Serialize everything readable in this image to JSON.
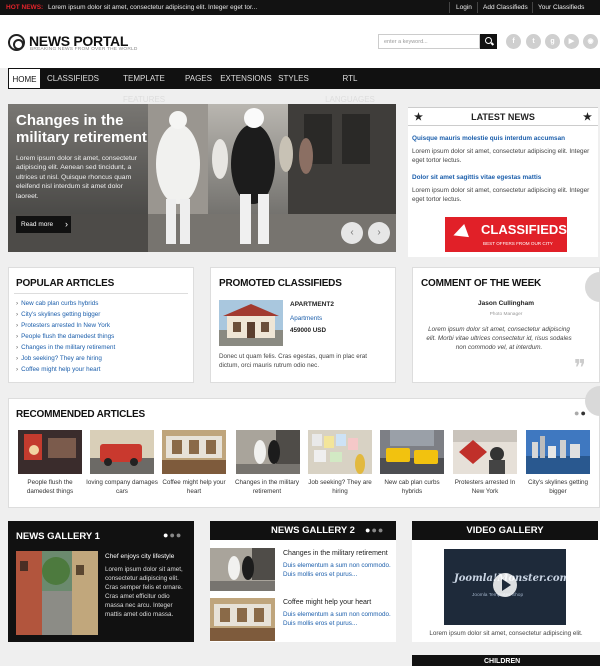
{
  "topbar": {
    "hot_label": "HOT NEWS:",
    "hot_text": "Lorem ipsum dolor sit amet, consectetur adipiscing elit. Integer eget tor...",
    "links": [
      "Login",
      "Add Classifieds",
      "Your Classifieds"
    ]
  },
  "header": {
    "logo_title": "NEWS PORTAL",
    "logo_tagline": "BREAKING NEWS FROM OVER THE WORLD",
    "search_placeholder": "enter a keyword...",
    "social_icons": [
      "facebook-icon",
      "twitter-icon",
      "googleplus-icon",
      "youtube-icon",
      "rss-icon"
    ]
  },
  "nav": {
    "items": [
      "HOME",
      "CLASSIFIEDS",
      "TEMPLATE FEATURES",
      "PAGES",
      "EXTENSIONS",
      "STYLES",
      "RTL LANGUAGES"
    ],
    "active": "HOME"
  },
  "slider": {
    "title_line1": "Changes in the",
    "title_line2": "military retirement",
    "text": "Lorem ipsum dolor sit amet, consectetur adipiscing elit. Aenean sed tincidunt, a ultrices ut nisl. Quisque rhoncus quam eleifend nisl interdum sit amet dolor laoreet.",
    "read_more": "Read more",
    "prev_arrow": "‹",
    "next_arrow": "›"
  },
  "latest_news": {
    "title": "LATEST NEWS",
    "items": [
      {
        "link": "Quisque mauris molestie quis interdum accumsan",
        "text": "Lorem ipsum dolor sit amet, consectetur adipiscing elit. Integer eget tortor lectus."
      },
      {
        "link": "Dolor sit amet sagittis vitae egestas mattis",
        "text": "Lorem ipsum dolor sit amet, consectetur adipiscing elit. Integer eget tortor lectus."
      }
    ]
  },
  "classifieds_banner": {
    "title": "CLASSIFIEDS",
    "subtitle": "BEST OFFERS FROM OUR CITY"
  },
  "popular": {
    "title": "POPULAR ARTICLES",
    "items": [
      "New cab plan curbs hybrids",
      "City's skylines getting bigger",
      "Protesters arrested In New York",
      "People flush the damedest things",
      "Changes in the military retirement",
      "Job seeking? They are hiring",
      "Coffee might help your heart"
    ]
  },
  "promoted": {
    "title": "PROMOTED CLASSIFIEDS",
    "item_name": "APARTMENT2",
    "item_category": "Apartments",
    "item_price": "459000 USD",
    "text": "Donec ut quam felis. Cras egestas, quam in plac erat dictum, orci mauris rutrum odio nec."
  },
  "comment": {
    "title": "COMMENT OF THE WEEK",
    "author": "Jason Cullingham",
    "role": "Photo Manager",
    "text": "Lorem ipsum dolor sit amet, consectetur adipiscing elit. Morbi vitae ultrices consectetur id, risus sodales non commodo vel, at interdum."
  },
  "recommended": {
    "title": "RECOMMENDED ARTICLES",
    "items": [
      "People flush the damedest things",
      "Ioving company damages cars",
      "Coffee might help your heart",
      "Changes in the military retirement",
      "Job seeking? They are hiring",
      "New cab plan curbs hybrids",
      "Protesters arrested In New York",
      "City's skylines getting bigger"
    ]
  },
  "gallery1": {
    "title": "NEWS GALLERY 1",
    "caption_title": "Chef enjoys city lifestyle",
    "caption_text": "Lorem ipsum dolor sit amet, consectetur adipiscing elit. Cras semper felis et ornare. Cras amet efficitur odio massa nec arcu. Integer mattis amet odio massa."
  },
  "gallery2": {
    "title": "NEWS GALLERY 2",
    "items": [
      {
        "title": "Changes in the military retirement",
        "text": "Duis elementum a sum non commodo. Duis mollis eros et purus..."
      },
      {
        "title": "Coffee might help your heart",
        "text": "Duis elementum a sum non commodo. Duis mollis eros et purus..."
      }
    ]
  },
  "video_gallery": {
    "title": "VIDEO GALLERY",
    "brand": "Joomla!Monster.com",
    "brand_sub": "Joomla Templates Shop",
    "caption": "Lorem ipsum dolor sit amet, consectetur adipiscing elit."
  },
  "bottom_hint": "CHILDREN"
}
